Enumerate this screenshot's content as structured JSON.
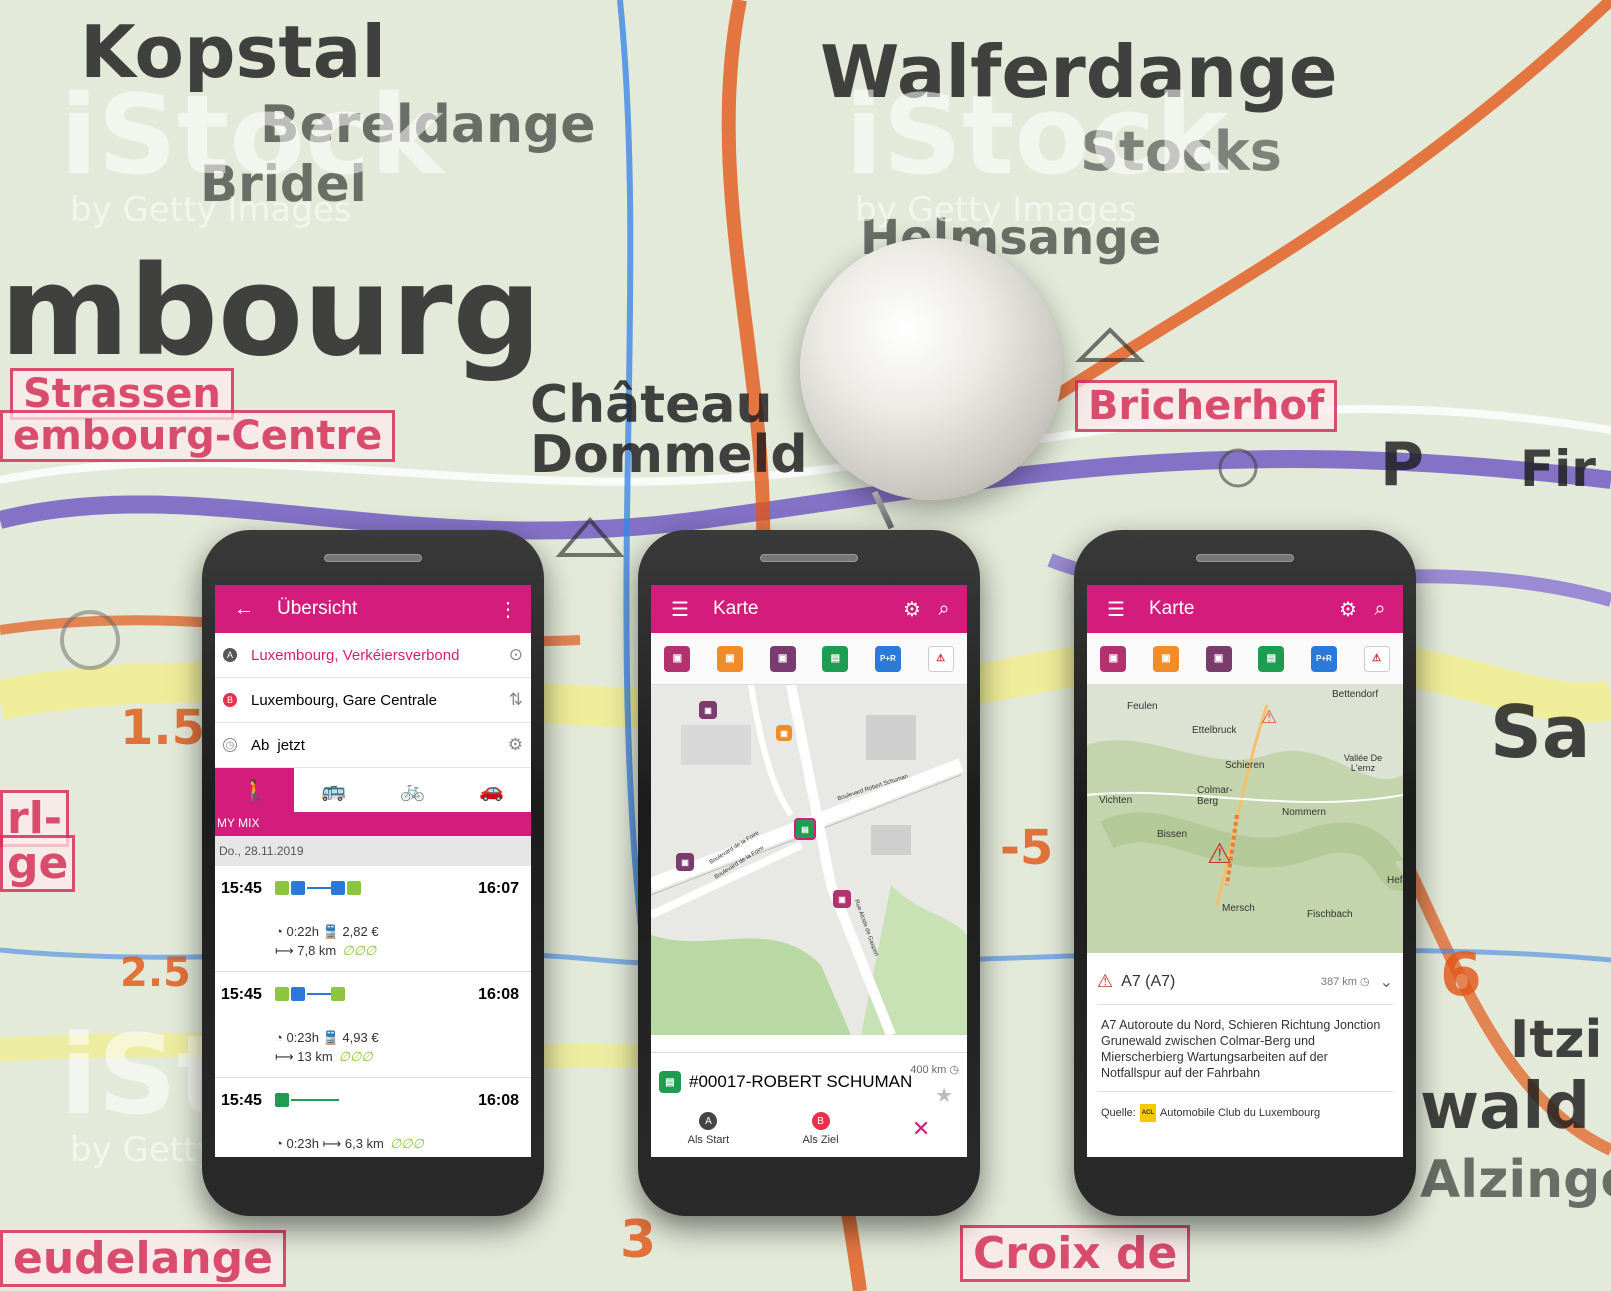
{
  "map_labels": {
    "kopstal": "Kopstal",
    "walferdange": "Walferdange",
    "bereldange": "Bereldange",
    "bridel": "Bridel",
    "steinsel": "Stocks",
    "helmsange": "Helmsange",
    "mbourg": "mbourg",
    "strassen": "Strassen",
    "lux_centre": "embourg-Centre",
    "chateau": "Château",
    "dommeldange": "Dommeld",
    "bricherhof": "Bricherhof",
    "p": "P",
    "fin": "Fir",
    "rl": "rl-",
    "ge": "ge",
    "croix": "Croix de",
    "waldhof": "wald",
    "alzingen": "Alzinge",
    "itzig": "Itzi",
    "leudelange": "eudelange",
    "num_1_5": "1.5",
    "num_2_5": "2.5",
    "num_5": "-5",
    "num_6": "6",
    "num_3": "3",
    "sa": "Sa"
  },
  "watermarks": [
    {
      "big": "iStock",
      "small": "by Getty Images"
    },
    {
      "big": "iStock",
      "small": "by Getty Images"
    },
    {
      "big": "iStock",
      "small": "by Getty Images"
    }
  ],
  "colors": {
    "brand": "#d41c7c"
  },
  "phone1": {
    "title": "Übersicht",
    "back_icon": "arrow-left-icon",
    "from": "Luxembourg, Verkéiersverbond",
    "to": "Luxembourg, Gare Centrale",
    "time_prefix": "Ab",
    "time_value": "jetzt",
    "mix_label": "MY MIX",
    "date": "Do., 28.11.2019",
    "trips": [
      {
        "dep": "15:45",
        "arr": "16:07",
        "line1": "0:22h  🚆 2,82 €",
        "line2": "⟼ 7,8 km",
        "leaves": "∅∅∅"
      },
      {
        "dep": "15:45",
        "arr": "16:08",
        "line1": "0:23h  🚆 4,93 €",
        "line2": "⟼ 13 km",
        "leaves": "∅∅∅"
      },
      {
        "dep": "15:45",
        "arr": "16:08",
        "line1": "0:23h  ⟼ 6,3 km",
        "line2": "",
        "leaves": "∅∅∅"
      }
    ]
  },
  "phone2": {
    "title": "Karte",
    "stop_name": "#00017-ROBERT SCHUMAN",
    "distance": "400 km",
    "start_label": "Als Start",
    "start_letter": "A",
    "end_label": "Als Ziel",
    "end_letter": "B",
    "streets": [
      "Boulevard Robert Schuman",
      "Boulevard de la Foire",
      "Boulevard de la Foire",
      "Rue Alcide de Gasperi"
    ]
  },
  "phone3": {
    "title": "Karte",
    "places": [
      "Feulen",
      "Ettelbruck",
      "Bettendorf",
      "Schieren",
      "Vallée De L'ernz",
      "Colmar-Berg",
      "Vichten",
      "Nommern",
      "Bissen",
      "Mersch",
      "Fischbach",
      "Hef"
    ],
    "alert_title": "A7 (A7)",
    "alert_distance": "387 km",
    "alert_text": "A7 Autoroute du Nord, Schieren Richtung Jonction Grunewald zwischen Colmar-Berg und Mierscherbierg Wartungsarbeiten auf der Notfallspur auf der Fahrbahn",
    "source_prefix": "Quelle:",
    "source_name": "Automobile Club du Luxembourg",
    "acl_logo": "ACL"
  }
}
